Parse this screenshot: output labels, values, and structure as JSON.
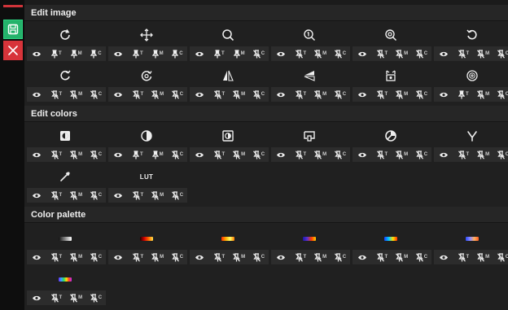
{
  "toolbar": {
    "save": {
      "icon": "save-icon",
      "color": "#24b36b"
    },
    "close": {
      "icon": "close-icon",
      "color": "#d8343a"
    }
  },
  "sections": [
    {
      "id": "edit-image",
      "title": "Edit image"
    },
    {
      "id": "edit-colors",
      "title": "Edit colors"
    },
    {
      "id": "color-palette",
      "title": "Color palette"
    }
  ],
  "edit_image_tools": [
    [
      "reset",
      "move",
      "zoom",
      "zoom-in",
      "zoom-out",
      "rotate-ccw"
    ],
    [
      "rotate-cw",
      "rotate-free",
      "flip-horizontal",
      "flip-vertical",
      "crop",
      "plus-circle"
    ]
  ],
  "edit_colors_tools": [
    [
      "levels",
      "contrast",
      "invert",
      "window-level",
      "saturation",
      "gamma"
    ],
    [
      "color-picker",
      "lut"
    ]
  ],
  "lut_label": "LUT",
  "palette_swatches": [
    [
      "grayscale",
      "hot",
      "jet-warm",
      "spectral",
      "rainbow",
      "cool-warm"
    ],
    [
      "multicolor"
    ]
  ],
  "control_labels": {
    "t": "T",
    "m": "M",
    "c": "C"
  },
  "pin_states": {
    "image_row1": [
      "eye pin pin pin",
      "eye off pin off",
      "eye pin pin off",
      "eye off off off",
      "eye off off off",
      "eye off off off"
    ],
    "image_row2": [
      "eye off off off",
      "eye off off off",
      "eye off off off",
      "eye off off off",
      "eye off off off",
      "eye pin off off"
    ]
  }
}
